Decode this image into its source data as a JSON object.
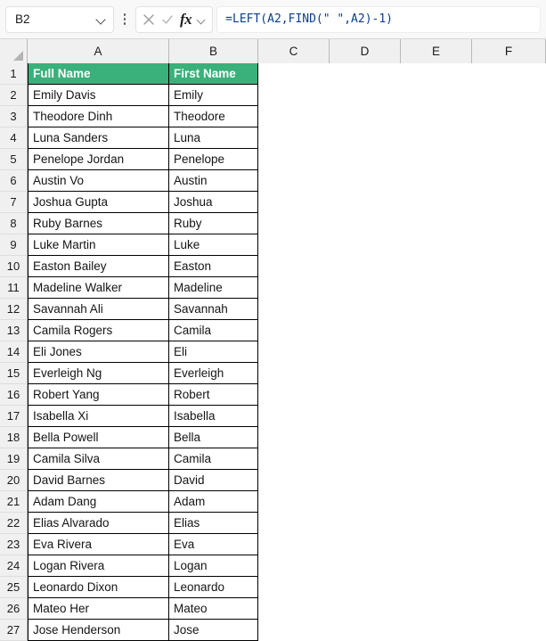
{
  "formula_bar": {
    "name_box_value": "B2",
    "name_box_icon": "chevron-down-icon",
    "kebab_icon": "more-options-icon",
    "cancel_icon": "cancel-x-icon",
    "confirm_icon": "confirm-check-icon",
    "fx_label": "fx",
    "fx_chevron_icon": "chevron-down-icon",
    "formula": "=LEFT(A2,FIND(\" \",A2)-1)"
  },
  "sheet": {
    "select_all_icon": "select-all-triangle-icon",
    "column_headers": [
      "A",
      "B",
      "C",
      "D",
      "E",
      "F"
    ],
    "row_numbers": [
      "1",
      "2",
      "3",
      "4",
      "5",
      "6",
      "7",
      "8",
      "9",
      "10",
      "11",
      "12",
      "13",
      "14",
      "15",
      "16",
      "17",
      "18",
      "19",
      "20",
      "21",
      "22",
      "23",
      "24",
      "25",
      "26",
      "27"
    ],
    "header_fill": "#3AB07A",
    "header_text_color": "#FFFFFF",
    "column_headers_labels": {
      "A": "Full Name",
      "B": "First Name"
    },
    "rows": [
      {
        "num": "1",
        "a": "Full Name",
        "b": "First Name"
      },
      {
        "num": "2",
        "a": "Emily Davis",
        "b": "Emily"
      },
      {
        "num": "3",
        "a": "Theodore Dinh",
        "b": "Theodore"
      },
      {
        "num": "4",
        "a": "Luna Sanders",
        "b": "Luna"
      },
      {
        "num": "5",
        "a": "Penelope Jordan",
        "b": "Penelope"
      },
      {
        "num": "6",
        "a": "Austin Vo",
        "b": "Austin"
      },
      {
        "num": "7",
        "a": "Joshua Gupta",
        "b": "Joshua"
      },
      {
        "num": "8",
        "a": "Ruby Barnes",
        "b": "Ruby"
      },
      {
        "num": "9",
        "a": "Luke Martin",
        "b": "Luke"
      },
      {
        "num": "10",
        "a": "Easton Bailey",
        "b": "Easton"
      },
      {
        "num": "11",
        "a": "Madeline Walker",
        "b": "Madeline"
      },
      {
        "num": "12",
        "a": "Savannah Ali",
        "b": "Savannah"
      },
      {
        "num": "13",
        "a": "Camila Rogers",
        "b": "Camila"
      },
      {
        "num": "14",
        "a": "Eli Jones",
        "b": "Eli"
      },
      {
        "num": "15",
        "a": "Everleigh Ng",
        "b": "Everleigh"
      },
      {
        "num": "16",
        "a": "Robert Yang",
        "b": "Robert"
      },
      {
        "num": "17",
        "a": "Isabella Xi",
        "b": "Isabella"
      },
      {
        "num": "18",
        "a": "Bella Powell",
        "b": "Bella"
      },
      {
        "num": "19",
        "a": "Camila Silva",
        "b": "Camila"
      },
      {
        "num": "20",
        "a": "David Barnes",
        "b": "David"
      },
      {
        "num": "21",
        "a": "Adam Dang",
        "b": "Adam"
      },
      {
        "num": "22",
        "a": "Elias Alvarado",
        "b": "Elias"
      },
      {
        "num": "23",
        "a": "Eva Rivera",
        "b": "Eva"
      },
      {
        "num": "24",
        "a": "Logan Rivera",
        "b": "Logan"
      },
      {
        "num": "25",
        "a": "Leonardo Dixon",
        "b": "Leonardo"
      },
      {
        "num": "26",
        "a": "Mateo Her",
        "b": "Mateo"
      },
      {
        "num": "27",
        "a": "Jose Henderson",
        "b": "Jose"
      }
    ]
  }
}
